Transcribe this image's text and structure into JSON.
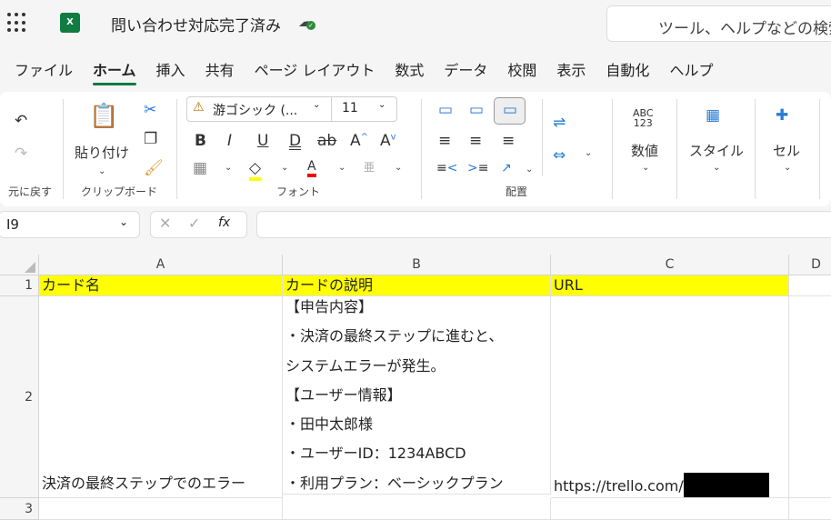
{
  "app": {
    "title": "問い合わせ対応完了済み",
    "search_placeholder": "ツール、ヘルプなどの検索"
  },
  "tabs": [
    "ファイル",
    "ホーム",
    "挿入",
    "共有",
    "ページ レイアウト",
    "数式",
    "データ",
    "校閲",
    "表示",
    "自動化",
    "ヘルプ"
  ],
  "ribbon": {
    "undo_group": "元に戻す",
    "clipboard_group": "クリップボード",
    "paste": "貼り付け",
    "font_group": "フォント",
    "font_name": "游ゴシック (...",
    "font_size": "11",
    "align_group": "配置",
    "number": "数値",
    "number_icon": "ABC\n123",
    "style": "スタイル",
    "cells": "セル"
  },
  "formula_bar": {
    "name_box": "I9",
    "fx": "fx",
    "value": ""
  },
  "sheet": {
    "columns": [
      "A",
      "B",
      "C",
      "D"
    ],
    "rows": [
      "1",
      "2",
      "3"
    ],
    "header": {
      "a": "カード名",
      "b": "カードの説明",
      "c": "URL"
    },
    "row2": {
      "a": "決済の最終ステップでのエラー",
      "b_lines": [
        "【申告内容】",
        "・決済の最終ステップに進むと、",
        "システムエラーが発生。",
        "【ユーザー情報】",
        "・田中太郎様",
        "・ユーザーID：1234ABCD",
        "・利用プラン：ベーシックプラン"
      ],
      "c": "https://trello.com/"
    }
  },
  "colors": {
    "accent": "#107c41",
    "highlight": "#ffff00"
  }
}
